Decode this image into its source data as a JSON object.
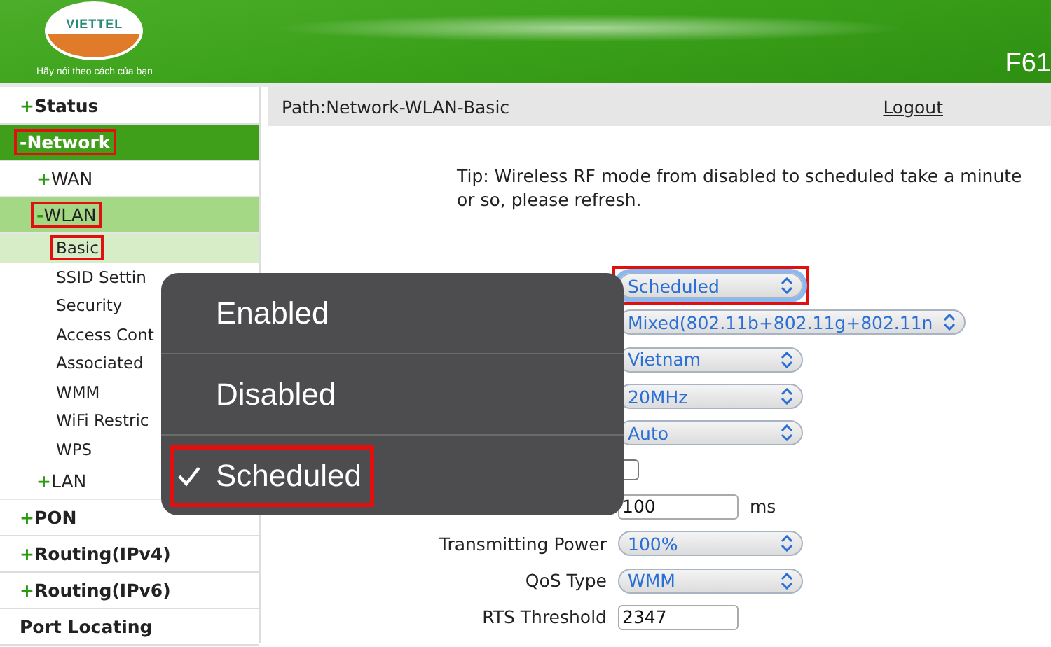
{
  "header": {
    "logo_text": "VIETTEL",
    "tagline": "Hãy nói theo cách của bạn",
    "model": "F61"
  },
  "sidebar": {
    "items": [
      {
        "label": "Status",
        "sign": "+",
        "selected": false,
        "highlighted": false
      },
      {
        "label": "Network",
        "sign": "-",
        "selected": true,
        "highlighted": true,
        "children": [
          {
            "label": "WAN",
            "sign": "+",
            "selected": false,
            "highlighted": false
          },
          {
            "label": "WLAN",
            "sign": "-",
            "selected": true,
            "highlighted": true,
            "children": [
              {
                "label": "Basic",
                "selected": true,
                "highlighted": true
              },
              {
                "label": "SSID Settin",
                "selected": false,
                "highlighted": false
              },
              {
                "label": "Security",
                "selected": false,
                "highlighted": false
              },
              {
                "label": "Access Cont",
                "selected": false,
                "highlighted": false
              },
              {
                "label": "Associated",
                "selected": false,
                "highlighted": false
              },
              {
                "label": "WMM",
                "selected": false,
                "highlighted": false
              },
              {
                "label": "WiFi Restric",
                "selected": false,
                "highlighted": false
              },
              {
                "label": "WPS",
                "selected": false,
                "highlighted": false
              }
            ]
          },
          {
            "label": "LAN",
            "sign": "+",
            "selected": false,
            "highlighted": false
          }
        ]
      },
      {
        "label": "PON",
        "sign": "+",
        "selected": false,
        "highlighted": false
      },
      {
        "label": "Routing(IPv4)",
        "sign": "+",
        "selected": false,
        "highlighted": false
      },
      {
        "label": "Routing(IPv6)",
        "sign": "+",
        "selected": false,
        "highlighted": false
      },
      {
        "label": "Port Locating",
        "selected": false,
        "highlighted": false
      }
    ]
  },
  "path": "Path:Network-WLAN-Basic",
  "logout": "Logout",
  "tip": "Tip: Wireless RF mode from disabled to scheduled take a minute or so, please refresh.",
  "form": [
    {
      "kind": "select",
      "value": "Scheduled",
      "focused": true,
      "highlighted": true
    },
    {
      "kind": "select",
      "value": "Mixed(802.11b+802.11g+802.11n",
      "focused": false,
      "highlighted": false
    },
    {
      "kind": "select",
      "value": "Vietnam",
      "focused": false,
      "highlighted": false
    },
    {
      "kind": "select",
      "value": "20MHz",
      "focused": false,
      "highlighted": false
    },
    {
      "kind": "select",
      "value": "Auto",
      "focused": false,
      "highlighted": false
    },
    {
      "kind": "checkbox",
      "checked": false
    },
    {
      "kind": "input",
      "value": "100",
      "unit": "ms"
    },
    {
      "kind": "select",
      "label": "Transmitting Power",
      "value": "100%",
      "focused": false,
      "highlighted": false
    },
    {
      "kind": "select",
      "label": "QoS Type",
      "value": "WMM",
      "focused": false,
      "highlighted": false
    },
    {
      "kind": "input",
      "label": "RTS Threshold",
      "value": "2347"
    }
  ],
  "popup": {
    "options": [
      {
        "label": "Enabled",
        "selected": false,
        "highlighted": false
      },
      {
        "label": "Disabled",
        "selected": false,
        "highlighted": false
      },
      {
        "label": "Scheduled",
        "selected": true,
        "highlighted": true
      }
    ]
  }
}
